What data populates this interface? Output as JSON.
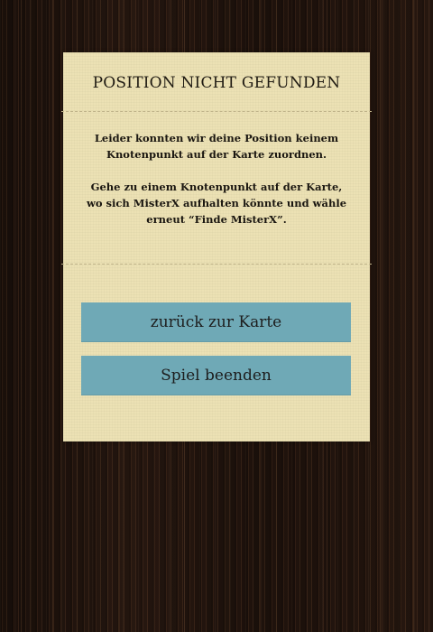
{
  "dialog": {
    "title": "POSITION NICHT GEFUNDEN",
    "message_1": "Leider konnten wir deine Position keinem Knotenpunkt auf der Karte zuordnen.",
    "message_2": "Gehe zu einem Knotenpunkt auf der Karte, wo sich MisterX aufhalten könnte und wähle erneut “Finde MisterX”.",
    "back_button_label": "zurück zur Karte",
    "quit_button_label": "Spiel beenden"
  },
  "colors": {
    "panel": "#ece1b4",
    "button": "#6fa9b6",
    "background": "#2a1a12"
  }
}
